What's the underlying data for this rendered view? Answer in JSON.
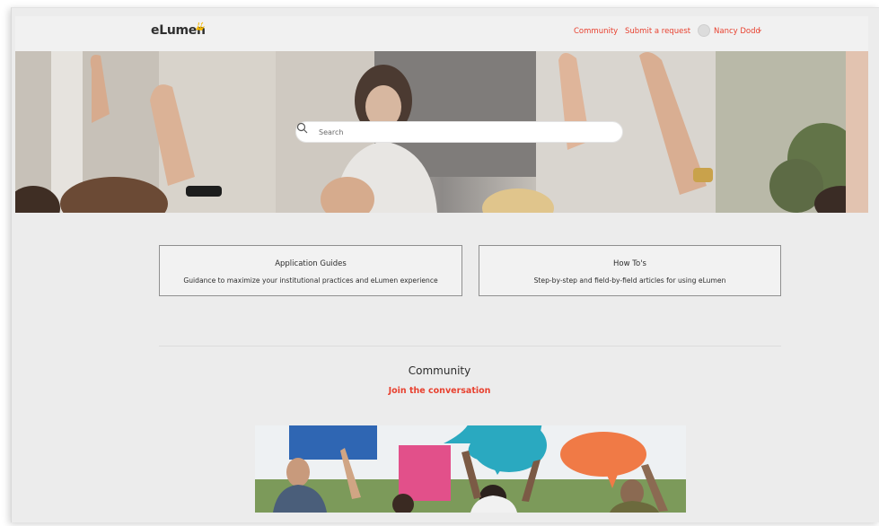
{
  "brand": {
    "name": "eLumen"
  },
  "header": {
    "links": [
      {
        "label": "Community"
      },
      {
        "label": "Submit a request"
      }
    ],
    "user": {
      "name": "Nancy Dodd",
      "caret": "⌄"
    }
  },
  "search": {
    "placeholder": "Search"
  },
  "cards": [
    {
      "title": "Application Guides",
      "description": "Guidance to maximize your institutional practices and eLumen experience"
    },
    {
      "title": "How To's",
      "description": "Step-by-step and field-by-field articles for using eLumen"
    }
  ],
  "community": {
    "heading": "Community",
    "subtitle": "Join the conversation"
  },
  "colors": {
    "accent": "#e8412f",
    "logo_star": "#f5b800"
  },
  "icons": [
    "search-icon",
    "logo-star-icon",
    "user-avatar-icon",
    "chevron-down-icon"
  ]
}
